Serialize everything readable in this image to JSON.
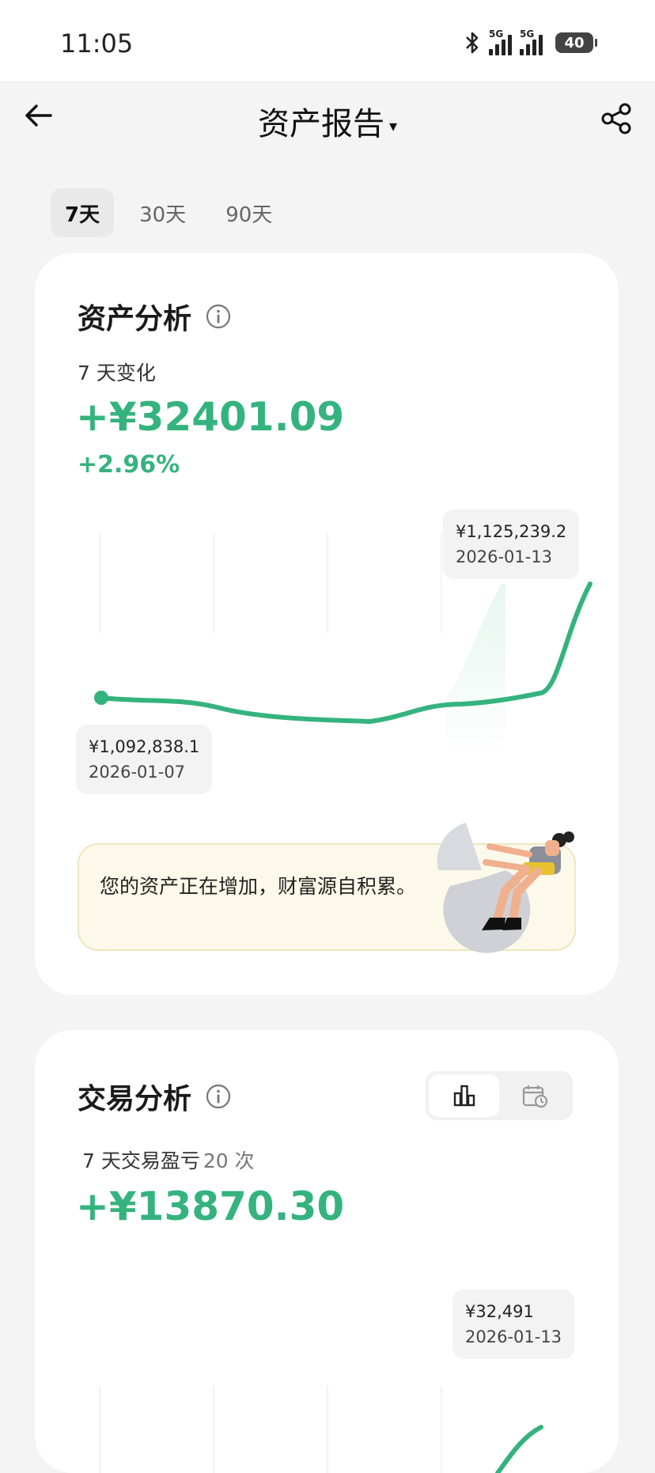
{
  "status_bar": {
    "time": "11:05",
    "network_1": "5G",
    "network_2": "5G",
    "battery": "40"
  },
  "header": {
    "title": "资产报告",
    "title_caret": "▾"
  },
  "range_tabs": [
    {
      "label": "7天",
      "active": true
    },
    {
      "label": "30天",
      "active": false
    },
    {
      "label": "90天",
      "active": false
    }
  ],
  "asset_card": {
    "title": "资产分析",
    "change_label": "7 天变化",
    "change_amount": "+¥32401.09",
    "change_percent": "+2.96%",
    "start_point": {
      "value": "¥1,092,838.1",
      "date": "2026-01-07"
    },
    "end_point": {
      "value": "¥1,125,239.2",
      "date": "2026-01-13"
    },
    "message": "您的资产正在增加，财富源自积累。"
  },
  "trade_card": {
    "title": "交易分析",
    "label": "7 天交易盈亏",
    "count": "20 次",
    "amount": "+¥13870.30",
    "end_point": {
      "value": "¥32,491",
      "date": "2026-01-13"
    }
  },
  "colors": {
    "accent_green": "#35b37e",
    "tip_bg": "#fdf9ea"
  }
}
